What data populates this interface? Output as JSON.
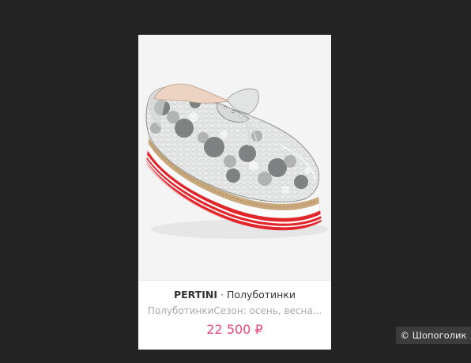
{
  "product": {
    "brand": "PERTINI",
    "separator": "·",
    "category": "Полуботинки",
    "description": "ПолуботинкиСезон: осень, весна...",
    "price": "22 500 ₽",
    "image_label": "shoe-photo"
  },
  "watermark": {
    "text": "© Шопоголик"
  },
  "colors": {
    "page_background": "#242424",
    "card_background": "#ffffff",
    "price_color": "#e8477a",
    "sole_red": "#e2252b",
    "jute_welt": "#c9a97c"
  }
}
